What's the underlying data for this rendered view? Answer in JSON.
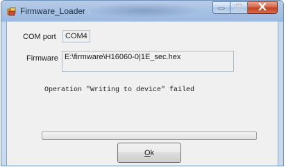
{
  "window": {
    "title": "Firmware_Loader",
    "accent": "#a9c3e3",
    "close_color": "#c2401f"
  },
  "form": {
    "com_port_label": "COM port",
    "com_port_value": "COM4",
    "firmware_label": "Firmware",
    "firmware_value": "E:\\firmware\\H16060-0|1E_sec.hex",
    "status_message": "Operation \"Writing to device\" failed"
  },
  "progress": {
    "value_percent": 0
  },
  "ok_button": {
    "accelerator": "O",
    "rest": "k"
  },
  "icons": {
    "app": "app-icon",
    "minimize": "minimize-icon",
    "maximize": "maximize-icon",
    "close": "close-icon"
  }
}
